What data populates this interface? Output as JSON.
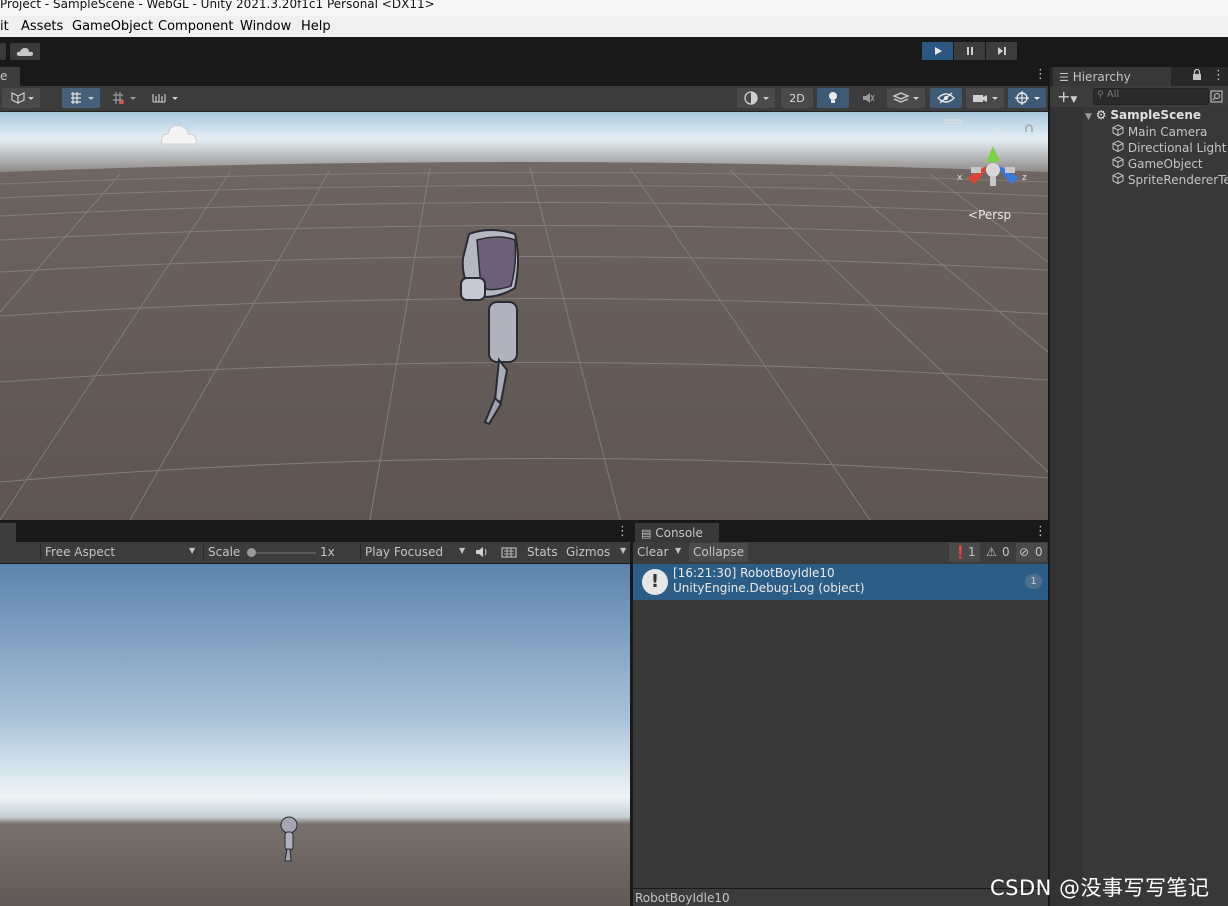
{
  "window": {
    "title": "Project - SampleScene - WebGL - Unity 2021.3.20f1c1 Personal <DX11>"
  },
  "menu": {
    "items": [
      "it",
      "Assets",
      "GameObject",
      "Component",
      "Window",
      "Help"
    ]
  },
  "scene": {
    "tab_label": "e",
    "mode_2d_label": "2D",
    "gizmo_axes": {
      "x": "x",
      "y": "y",
      "z": "z"
    },
    "projection_label": "Persp"
  },
  "hierarchy": {
    "tab_label": "Hierarchy",
    "search_placeholder": "All",
    "scene_name": "SampleScene",
    "items": [
      "Main Camera",
      "Directional Light",
      "GameObject",
      "SpriteRendererTe"
    ]
  },
  "game": {
    "aspect_label": "Free Aspect",
    "scale_label": "Scale",
    "scale_value": "1x",
    "play_mode_label": "Play Focused",
    "stats_label": "Stats",
    "gizmos_label": "Gizmos"
  },
  "console": {
    "tab_label": "Console",
    "clear_label": "Clear",
    "collapse_label": "Collapse",
    "counts": {
      "log": "1",
      "warn": "0",
      "error": "0"
    },
    "entry": {
      "line1": "[16:21:30] RobotBoyIdle10",
      "line2": "UnityEngine.Debug:Log (object)",
      "count": "1"
    },
    "status_text": "RobotBoyIdle10"
  },
  "watermark": "CSDN @没事写写笔记",
  "colors": {
    "selection": "#2c5d87",
    "panel": "#383838",
    "toolbar": "#3c3c3c",
    "play_active": "#2b5882"
  }
}
